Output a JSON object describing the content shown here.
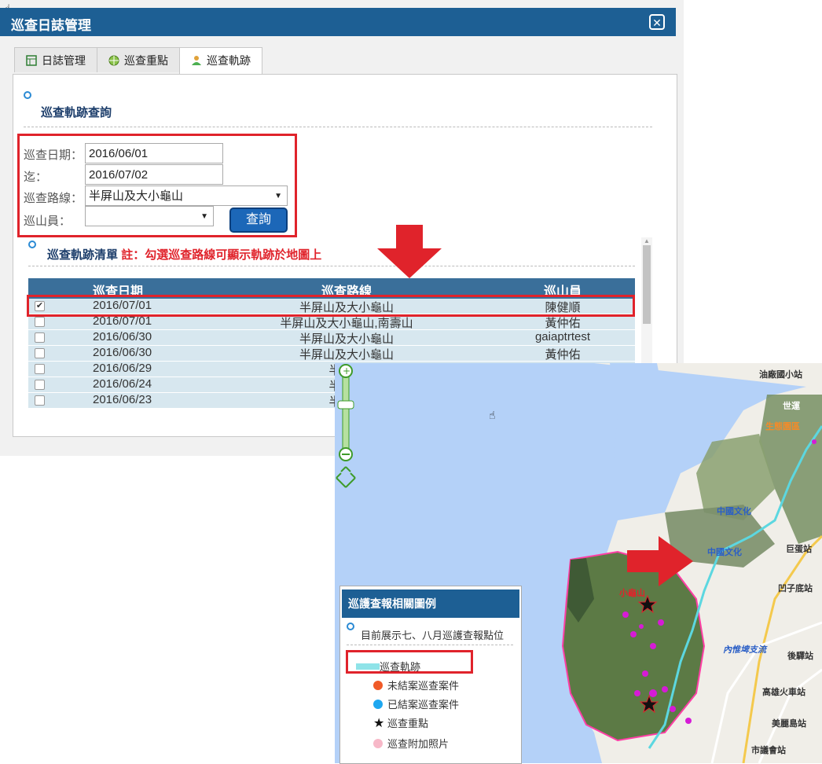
{
  "window": {
    "title": "巡查日誌管理"
  },
  "tabs": [
    {
      "label": "日誌管理",
      "icon": "calendar-icon"
    },
    {
      "label": "巡查重點",
      "icon": "target-icon"
    },
    {
      "label": "巡查軌跡",
      "icon": "user-icon"
    }
  ],
  "query": {
    "section_title": "巡查軌跡查詢",
    "date_from_label": "巡查日期：",
    "date_from_value": "2016/06/01",
    "date_to_label": "迄：",
    "date_to_value": "2016/07/02",
    "route_label": "巡查路線：",
    "route_value": "半屏山及大小龜山",
    "staff_label": "巡山員：",
    "staff_value": "",
    "submit_label": "查詢"
  },
  "list": {
    "section_title": "巡查軌跡清單",
    "note": "註：勾選巡查路線可顯示軌跡於地圖上",
    "columns": [
      "巡查日期",
      "巡查路線",
      "巡山員"
    ],
    "rows": [
      {
        "checked": true,
        "date": "2016/07/01",
        "route": "半屏山及大小龜山",
        "staff": "陳健順"
      },
      {
        "checked": false,
        "date": "2016/07/01",
        "route": "半屏山及大小龜山,南壽山",
        "staff": "黃仲佑"
      },
      {
        "checked": false,
        "date": "2016/06/30",
        "route": "半屏山及大小龜山",
        "staff": "gaiaptrtest"
      },
      {
        "checked": false,
        "date": "2016/06/30",
        "route": "半屏山及大小龜山",
        "staff": "黃仲佑"
      },
      {
        "checked": false,
        "date": "2016/06/29",
        "route": "半屏山",
        "staff": ""
      },
      {
        "checked": false,
        "date": "2016/06/24",
        "route": "半屏山",
        "staff": ""
      },
      {
        "checked": false,
        "date": "2016/06/23",
        "route": "半屏山",
        "staff": ""
      }
    ]
  },
  "legend": {
    "title": "巡護查報相關圖例",
    "subtitle": "目前展示七、八月巡護查報點位",
    "items": [
      {
        "label": "巡查軌跡",
        "color": "#8fe3e8"
      },
      {
        "label": "未結案巡查案件",
        "color": "#f05a28"
      },
      {
        "label": "已結案巡查案件",
        "color": "#1ea7f0"
      },
      {
        "label": "巡查重點",
        "color": "#111111"
      },
      {
        "label": "巡查附加照片",
        "color": "#f7b8c8"
      }
    ]
  },
  "map_labels": {
    "stations": [
      "油廠國小站",
      "世運",
      "生態園區",
      "巨蛋站",
      "凹子底站",
      "後驛站",
      "高雄火車站",
      "美麗島站",
      "市議會站"
    ],
    "places": [
      "中國文化",
      "內惟埤支流",
      "小龜山"
    ]
  }
}
